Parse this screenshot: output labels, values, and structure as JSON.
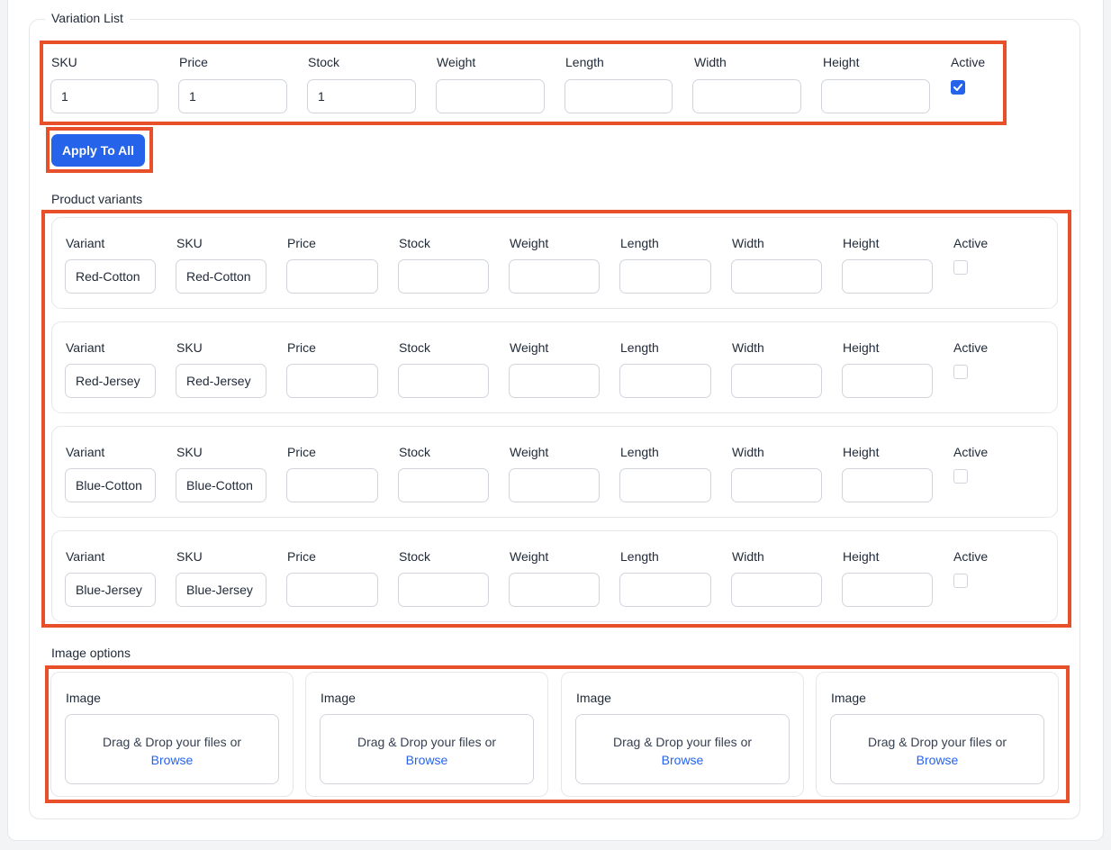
{
  "variation_list": {
    "legend": "Variation List",
    "headers": {
      "sku": "SKU",
      "price": "Price",
      "stock": "Stock",
      "weight": "Weight",
      "length": "Length",
      "width": "Width",
      "height": "Height",
      "active": "Active"
    },
    "values": {
      "sku": "1",
      "price": "1",
      "stock": "1",
      "weight": "",
      "length": "",
      "width": "",
      "height": "",
      "active": true
    },
    "apply_label": "Apply To All"
  },
  "product_variants": {
    "title": "Product variants",
    "headers": {
      "variant": "Variant",
      "sku": "SKU",
      "price": "Price",
      "stock": "Stock",
      "weight": "Weight",
      "length": "Length",
      "width": "Width",
      "height": "Height",
      "active": "Active"
    },
    "rows": [
      {
        "variant": "Red-Cotton",
        "sku": "Red-Cotton",
        "price": "",
        "stock": "",
        "weight": "",
        "length": "",
        "width": "",
        "height": "",
        "active": false
      },
      {
        "variant": "Red-Jersey",
        "sku": "Red-Jersey",
        "price": "",
        "stock": "",
        "weight": "",
        "length": "",
        "width": "",
        "height": "",
        "active": false
      },
      {
        "variant": "Blue-Cotton",
        "sku": "Blue-Cotton",
        "price": "",
        "stock": "",
        "weight": "",
        "length": "",
        "width": "",
        "height": "",
        "active": false
      },
      {
        "variant": "Blue-Jersey",
        "sku": "Blue-Jersey",
        "price": "",
        "stock": "",
        "weight": "",
        "length": "",
        "width": "",
        "height": "",
        "active": false
      }
    ]
  },
  "image_options": {
    "title": "Image options",
    "cards": [
      {
        "label": "Image",
        "drop_text": "Drag & Drop your files or",
        "browse": "Browse"
      },
      {
        "label": "Image",
        "drop_text": "Drag & Drop your files or",
        "browse": "Browse"
      },
      {
        "label": "Image",
        "drop_text": "Drag & Drop your files or",
        "browse": "Browse"
      },
      {
        "label": "Image",
        "drop_text": "Drag & Drop your files or",
        "browse": "Browse"
      }
    ]
  },
  "colors": {
    "accent": "#2563eb",
    "highlight": "#e8502a",
    "border": "#d1d5db"
  }
}
